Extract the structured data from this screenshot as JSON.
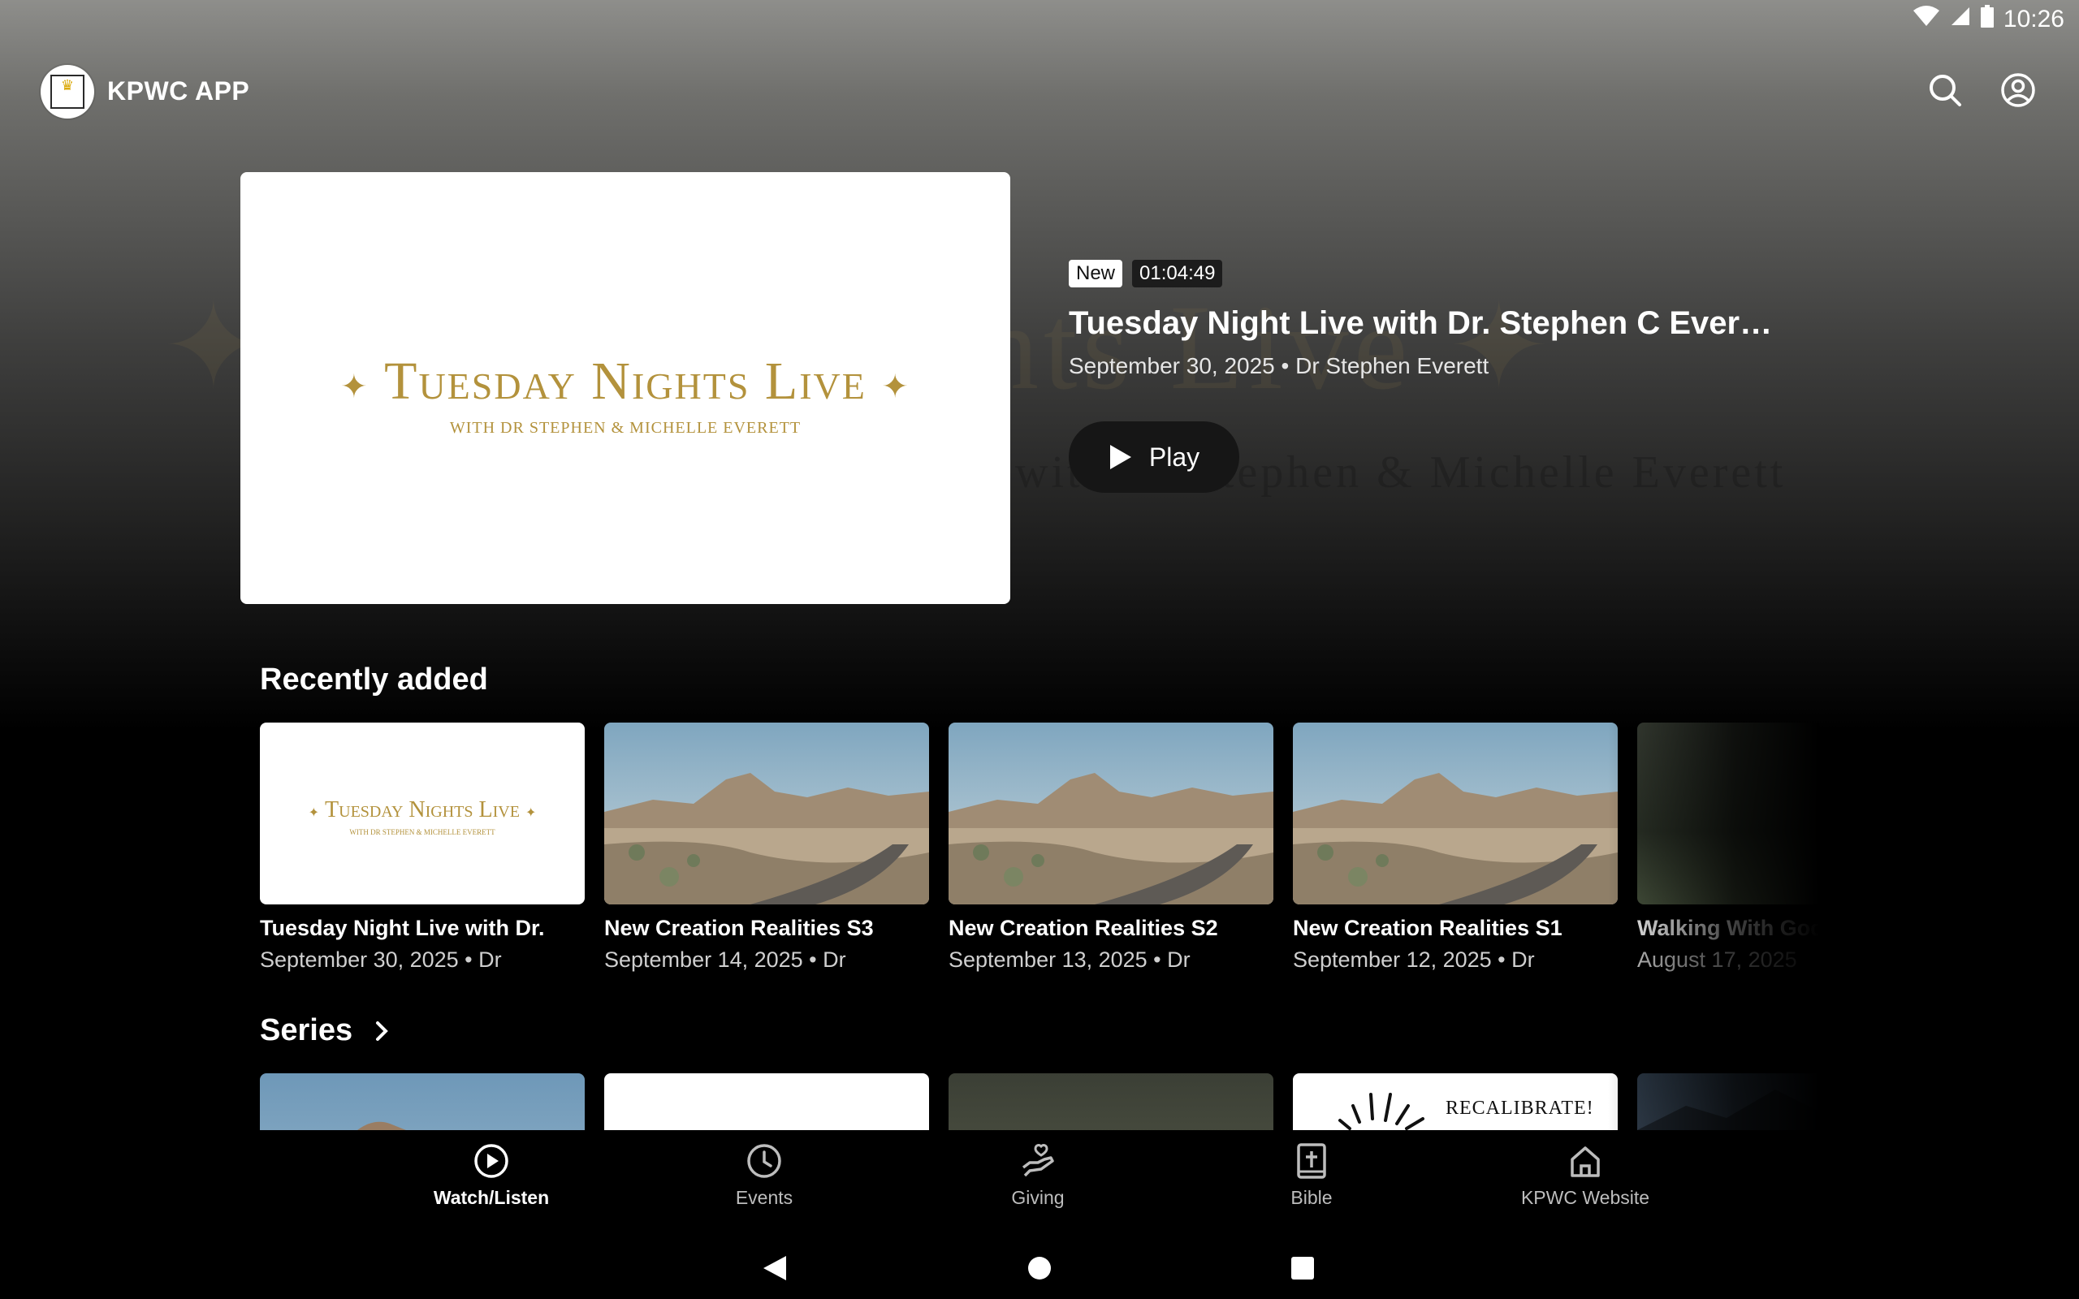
{
  "status_bar": {
    "time": "10:26"
  },
  "app": {
    "title": "KPWC APP"
  },
  "hero": {
    "thumb_title": "Tuesday Nights Live",
    "thumb_subtitle": "with Dr Stephen & Michelle Everett",
    "badge_new": "New",
    "duration": "01:04:49",
    "title": "Tuesday Night Live with Dr. Stephen C Everet…",
    "meta": "September 30, 2025 • Dr Stephen Everett",
    "play_label": "Play",
    "ghost_text": "✦ Tuesday Nights Live ✦",
    "ghost_sub": "with Dr Stephen & Michelle Everett"
  },
  "recently_added": {
    "title": "Recently added",
    "items": [
      {
        "title": "Tuesday Night Live with Dr.",
        "meta": "September 30, 2025 • Dr",
        "thumb": "tnl"
      },
      {
        "title": "New Creation Realities S3",
        "meta": "September 14, 2025 • Dr",
        "thumb": "desert-road"
      },
      {
        "title": "New Creation Realities S2",
        "meta": "September 13, 2025 • Dr",
        "thumb": "desert-road"
      },
      {
        "title": "New Creation Realities S1",
        "meta": "September 12, 2025 • Dr",
        "thumb": "desert-road"
      },
      {
        "title": "Walking With God",
        "meta": "August 17, 2025",
        "thumb": "grass"
      }
    ]
  },
  "series": {
    "title": "Series",
    "recalibrate_text": "Recalibrate!"
  },
  "bottom_nav": [
    {
      "label": "Watch/Listen",
      "icon": "play-circle-icon",
      "active": true
    },
    {
      "label": "Events",
      "icon": "clock-icon",
      "active": false
    },
    {
      "label": "Giving",
      "icon": "giving-hand-icon",
      "active": false
    },
    {
      "label": "Bible",
      "icon": "bible-icon",
      "active": false
    },
    {
      "label": "KPWC Website",
      "icon": "home-icon",
      "active": false
    }
  ],
  "colors": {
    "gold": "#b3923c",
    "background": "#000000",
    "accent": "#ffffff"
  }
}
